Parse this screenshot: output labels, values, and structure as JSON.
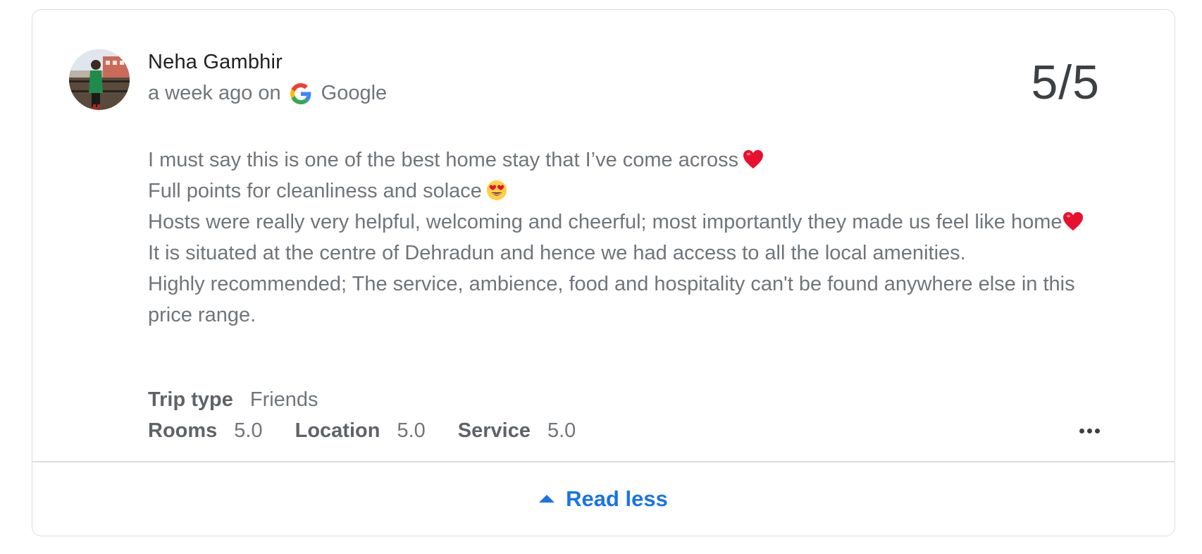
{
  "review": {
    "author": "Neha Gambhir",
    "time_text": "a week ago on",
    "source": "Google",
    "source_icon": "google-g-icon",
    "score": "5/5",
    "lines": [
      "I must say this is one of the best home stay that I’ve come across",
      "Full points for cleanliness and solace",
      "Hosts were really very helpful, welcoming and cheerful; most importantly they made us feel like home",
      "It is situated at the centre of Dehradun and hence we had access to all the local amenities.",
      "Highly recommended; The service, ambience, food and hospitality can't be found anywhere else in this price range."
    ],
    "emojis": [
      "red-heart-emoji",
      "heart-eyes-emoji",
      "red-heart-emoji"
    ],
    "trip_type_label": "Trip type",
    "trip_type_value": "Friends",
    "ratings": [
      {
        "label": "Rooms",
        "value": "5.0"
      },
      {
        "label": "Location",
        "value": "5.0"
      },
      {
        "label": "Service",
        "value": "5.0"
      }
    ]
  },
  "actions": {
    "more_icon": "more-horiz-icon",
    "read_less_label": "Read less",
    "read_less_icon": "caret-up-icon"
  },
  "colors": {
    "link": "#1a73e8",
    "text_primary": "#202124",
    "text_secondary": "#70757a",
    "border": "#dadce0"
  }
}
